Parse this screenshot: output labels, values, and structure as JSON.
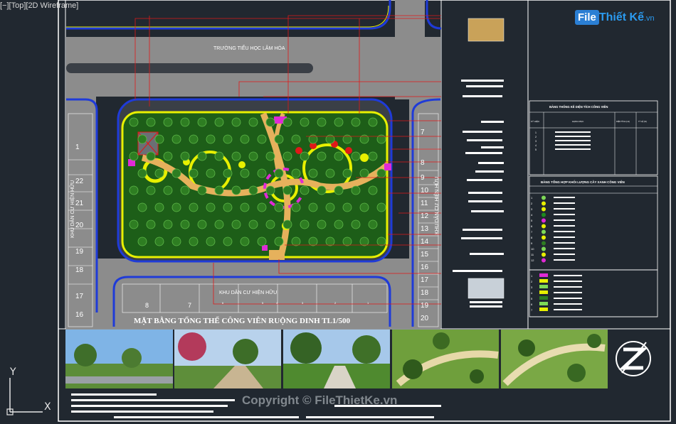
{
  "viewport": {
    "label": "[−][Top][2D Wireframe]"
  },
  "site": {
    "top_road_label": "TRƯỜNG TIỂU HỌC LÂM HÓA",
    "bottom_area_label": "KHU DÂN CƯ HIỆN HỮU",
    "left_area_label": "KHU DÂN CƯ HIỆN HỮU",
    "right_area_label": "KHU DÂN CƯ HIỆN HỮU",
    "left_lot_numbers": [
      "1",
      "22",
      "21",
      "20",
      "19",
      "18",
      "17",
      "16"
    ],
    "right_lot_numbers": [
      "7",
      "8",
      "9",
      "10",
      "11",
      "12",
      "13",
      "14",
      "15",
      "16",
      "17",
      "18",
      "19",
      "20"
    ],
    "bottom_lot_numbers": [
      "8",
      "7",
      "6",
      "5",
      "4",
      "3",
      "2",
      "1"
    ]
  },
  "drawing": {
    "title": "MẶT BẰNG TỔNG THỂ CÔNG VIÊN RUỘNG DINH TL1/500"
  },
  "title_block": {
    "table1_title": "BẢNG THỐNG KÊ DIỆN TÍCH CÔNG VIÊN",
    "table1_headers": [
      "KÝ HIỆU",
      "HẠNG MỤC",
      "DIỆN TÍCH (m2)",
      "TỶ LỆ (%)"
    ],
    "table1_row_numbers": [
      "1",
      "2",
      "3",
      "4",
      "5"
    ],
    "table2_title": "BẢNG TỔNG HỢP KHỐI LƯỢNG CÂY XANH CÔNG VIÊN",
    "table2_row_numbers": [
      "1",
      "2",
      "3",
      "4",
      "5",
      "6",
      "7",
      "8",
      "9",
      "10",
      "11",
      "12"
    ],
    "table3_row_numbers": [
      "1",
      "2",
      "3",
      "4",
      "5",
      "6",
      "7"
    ]
  },
  "ucs": {
    "y_label": "Y",
    "x_label": "X"
  },
  "watermark": {
    "logo_box": "File",
    "logo_rest": "Thiết Kế",
    "logo_domain": ".vn",
    "copyright": "Copyright © FileThietKe.vn"
  },
  "colors": {
    "background": "#212830",
    "frame": "#ffffff",
    "road": "#8c8c8c",
    "grass": "#1d5e18",
    "park_border": "#e8f000",
    "curb": "#1f3bd8",
    "leader": "#e01818",
    "path": "#e6b15c",
    "magenta": "#e02ad6"
  }
}
